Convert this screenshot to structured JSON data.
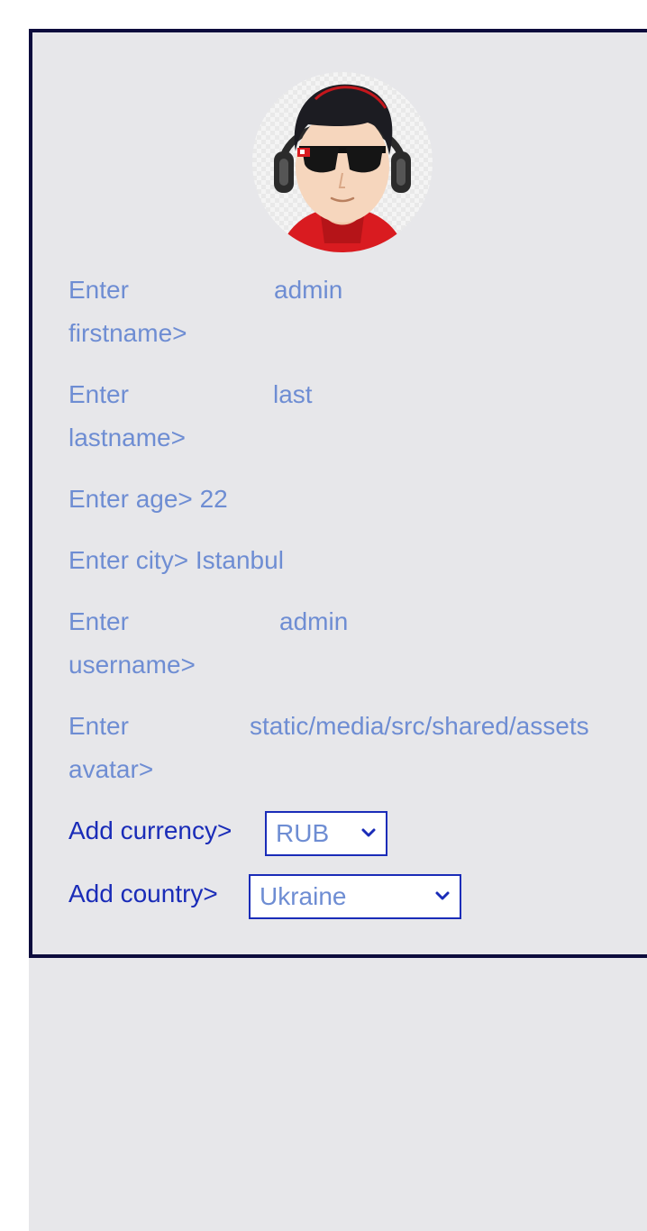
{
  "profile": {
    "avatar_alt": "avatar",
    "fields": {
      "firstname": {
        "label_line1": "Enter",
        "label_line2": "firstname>",
        "value": "admin"
      },
      "lastname": {
        "label_line1": "Enter",
        "label_line2": "lastname>",
        "value": "last"
      },
      "age": {
        "label": "Enter age>",
        "value": "22"
      },
      "city": {
        "label": "Enter city>",
        "value": "Istanbul"
      },
      "username": {
        "label_line1": "Enter",
        "label_line2": "username>",
        "value": "admin"
      },
      "avatar": {
        "label_line1": "Enter",
        "label_line2": "avatar>",
        "value": "static/media/src/shared/assets"
      }
    },
    "currency": {
      "label": "Add currency>",
      "selected": "RUB"
    },
    "country": {
      "label": "Add country>",
      "selected": "Ukraine"
    }
  },
  "colors": {
    "border": "#0d0c3d",
    "panel_bg": "#e7e7ea",
    "field_text": "#6e8dd3",
    "select_label": "#1a2cb8"
  }
}
